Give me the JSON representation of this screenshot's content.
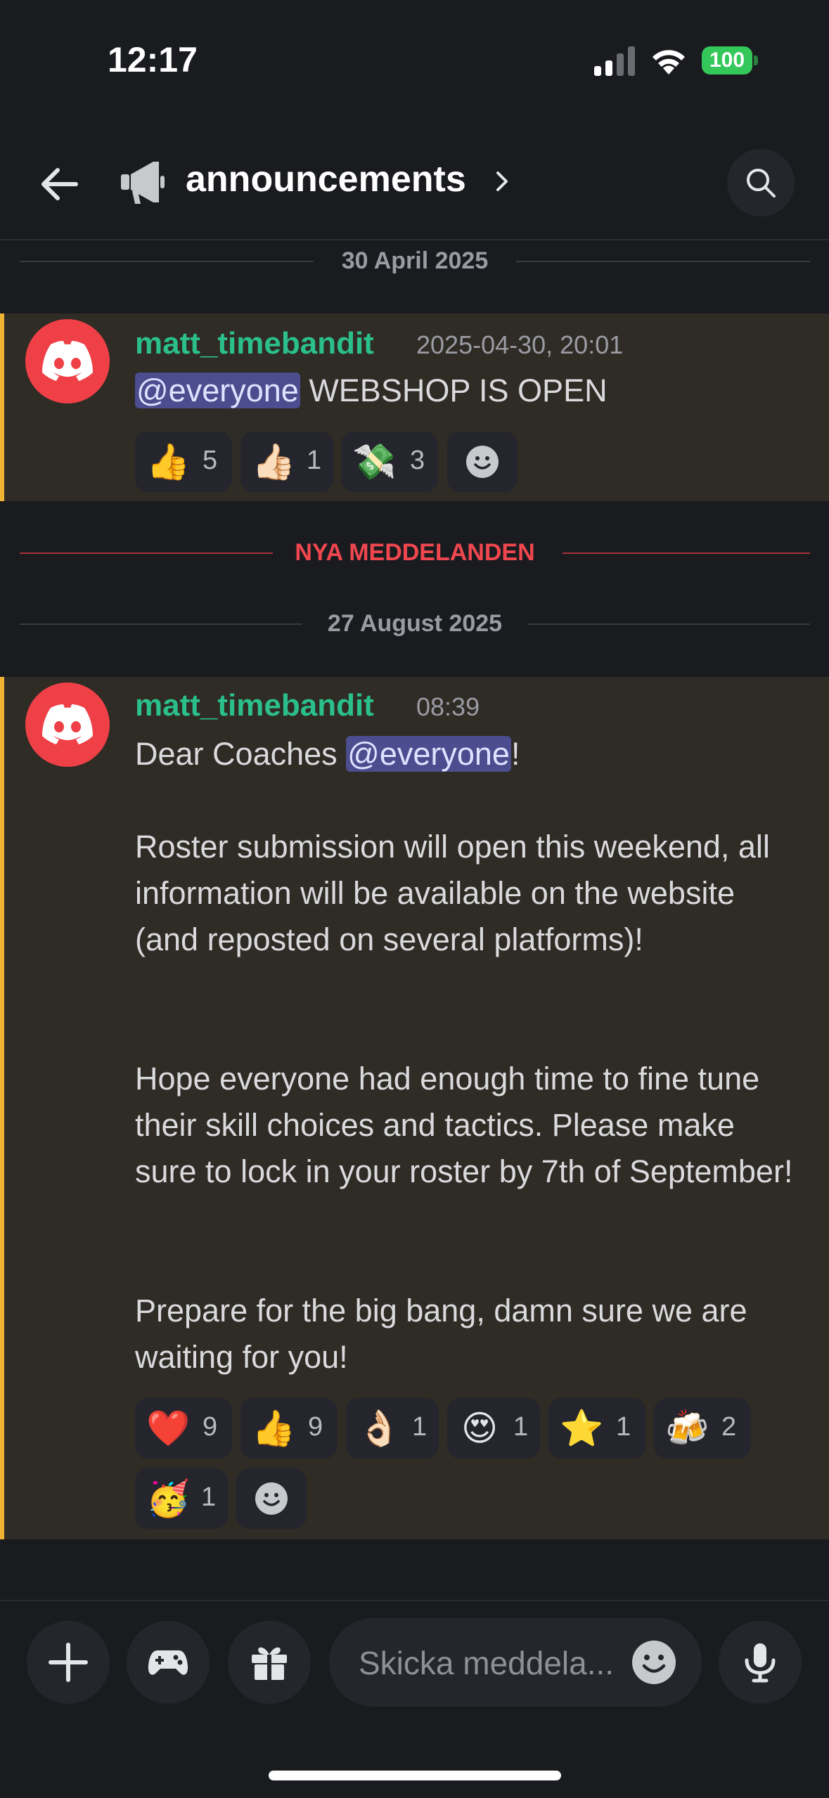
{
  "status_bar": {
    "time": "12:17",
    "battery": "100"
  },
  "header": {
    "channel_name": "announcements"
  },
  "dividers": {
    "date1": "30 April 2025",
    "new_messages": "NYA MEDDELANDEN",
    "date2": "27 August 2025"
  },
  "messages": [
    {
      "author": "matt_timebandit",
      "timestamp": "2025-04-30, 20:01",
      "mention": "@everyone",
      "text": " WEBSHOP IS OPEN",
      "reactions": [
        {
          "emoji": "👍",
          "count": "5"
        },
        {
          "emoji": "👍🏻",
          "count": "1"
        },
        {
          "emoji": "💸",
          "count": "3"
        }
      ]
    },
    {
      "author": "matt_timebandit",
      "timestamp": "08:39",
      "text_before": "Dear Coaches ",
      "mention": "@everyone",
      "text_after": "!",
      "paragraph1": "Roster submission will open this weekend, all information will be available on the website (and reposted on several platforms)!",
      "paragraph2": "Hope everyone had enough time to fine tune their skill choices and tactics. Please make sure to lock in your roster by 7th of September!",
      "paragraph3": "Prepare for the big bang, damn sure we are waiting for you!",
      "reactions": [
        {
          "emoji": "❤️",
          "count": "9"
        },
        {
          "emoji": "👍",
          "count": "9"
        },
        {
          "emoji": "👌🏻",
          "count": "1"
        },
        {
          "emoji": "😍",
          "count": "1"
        },
        {
          "emoji": "⭐",
          "count": "1"
        },
        {
          "emoji": "🍻",
          "count": "2"
        },
        {
          "emoji": "🥳",
          "count": "1"
        }
      ]
    }
  ],
  "composer": {
    "placeholder": "Skicka meddela..."
  },
  "colors": {
    "accent_bar": "#f0b232",
    "author": "#2bbf8c",
    "mention_bg": "#4b4d8f",
    "new_divider": "#f0474f"
  }
}
